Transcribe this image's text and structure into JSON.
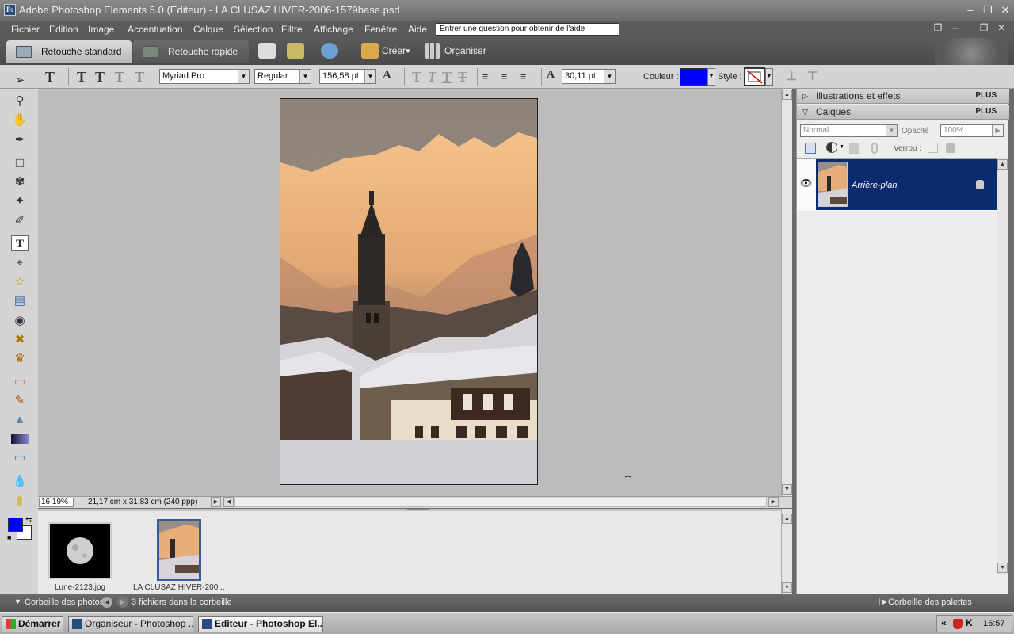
{
  "window": {
    "title": "Adobe Photoshop Elements 5.0 (Editeur) - LA CLUSAZ HIVER-2006-1579base.psd"
  },
  "menu": {
    "items": [
      "Fichier",
      "Edition",
      "Image",
      "Accentuation",
      "Calque",
      "Sélection",
      "Affichage",
      "Filtre",
      "Fenêtre",
      "Aide"
    ],
    "help_placeholder": "Entrer une question pour obtenir de l'aide"
  },
  "topbar": {
    "tab_standard": "Retouche standard",
    "tab_rapide": "Retouche rapide",
    "create_label": "Créer",
    "organize_label": "Organiser"
  },
  "options": {
    "font_family": "Myriad Pro",
    "font_style": "Regular",
    "font_size": "156,58 pt",
    "leading": "30,11 pt",
    "color_label": "Couleur :",
    "style_label": "Style :",
    "color_value": "#0000ff"
  },
  "status": {
    "zoom": "16,19%",
    "doc_info": "21,17 cm x 31,83 cm (240 ppp)"
  },
  "photo_bin": {
    "items": [
      {
        "label": "Lune-2123.jpg"
      },
      {
        "label": "LA CLUSAZ HIVER-200..."
      }
    ]
  },
  "palettes": {
    "illustrations_title": "Illustrations et effets",
    "calques_title": "Calques",
    "plus_label": "PLUS",
    "blend_mode": "Normal",
    "opacity_label": "Opacité :",
    "opacity_value": "100%",
    "lock_label": "Verrou :",
    "layer_name": "Arrière-plan"
  },
  "bottombar": {
    "bin_label": "Corbeille des photos",
    "bin_count": "3 fichiers dans la corbeille",
    "palette_bin_label": "Corbeille des palettes"
  },
  "taskbar": {
    "start_label": "Démarrer",
    "task1": "Organiseur - Photoshop ...",
    "task2": "Editeur - Photoshop El...",
    "clock": "16:57"
  },
  "colors": {
    "accent_layer": "#0c2a6e",
    "foreground": "#0000ff"
  }
}
